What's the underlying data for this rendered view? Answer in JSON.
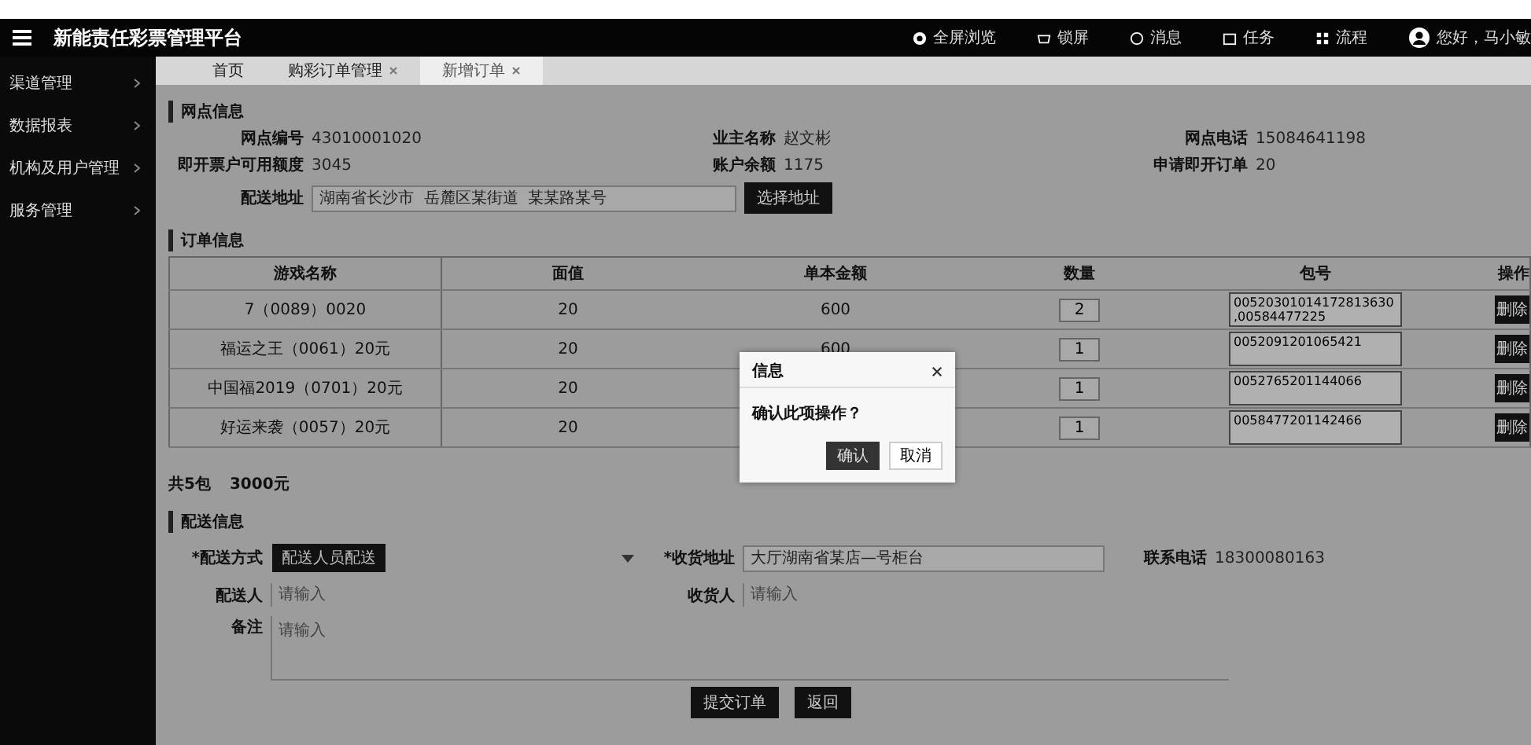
{
  "app": {
    "title": "新能责任彩票管理平台"
  },
  "top_nav": [
    {
      "kind": "fullscreen",
      "label": "全屏浏览"
    },
    {
      "kind": "lock",
      "label": "锁屏"
    },
    {
      "kind": "message",
      "label": "消息"
    },
    {
      "kind": "task",
      "label": "任务"
    },
    {
      "kind": "flow",
      "label": "流程"
    }
  ],
  "user": {
    "label": "您好，马小敏"
  },
  "sidebar": {
    "items": [
      {
        "label": "渠道管理"
      },
      {
        "label": "数据报表"
      },
      {
        "label": "机构及用户管理"
      },
      {
        "label": "服务管理"
      }
    ]
  },
  "tabs": [
    {
      "label": "首页",
      "selected": false,
      "closable": false
    },
    {
      "label": "购彩订单管理",
      "selected": false,
      "closable": true
    },
    {
      "label": "新增订单",
      "selected": true,
      "closable": true
    }
  ],
  "outlet": {
    "title": "网点信息",
    "fields": [
      {
        "label": "网点编号",
        "value": "43010001020"
      },
      {
        "label": "业主名称",
        "value": "赵文彬"
      },
      {
        "label": "网点电话",
        "value": "15084641198"
      },
      {
        "label": "即开票户可用额度",
        "value": "3045"
      },
      {
        "label": "账户余额",
        "value": "1175"
      },
      {
        "label": "申请即开订单",
        "value": "20"
      }
    ],
    "address": {
      "label": "配送地址",
      "value": "湖南省长沙市  岳麓区某街道  某某路某号",
      "button": "选择地址"
    }
  },
  "order": {
    "title": "订单信息",
    "columns": [
      "游戏名称",
      "面值",
      "单本金额",
      "数量",
      "包号",
      "操作"
    ],
    "rows": [
      {
        "game": "7（0089）0020",
        "face": "20",
        "amount": "600",
        "qty": "2",
        "packs": "00520301014172813630,00584477225",
        "action": "删除"
      },
      {
        "game": "福运之王（0061）20元",
        "face": "20",
        "amount": "600",
        "qty": "1",
        "packs": "0052091201065421",
        "action": "删除"
      },
      {
        "game": "中国福2019（0701）20元",
        "face": "20",
        "qty": "1",
        "packs": "0052765201144066",
        "action": "删除"
      },
      {
        "game": "好运来袭（0057）20元",
        "face": "20",
        "qty": "1",
        "packs": "0058477201142466",
        "action": "删除"
      }
    ],
    "total_packs": "共5包",
    "total_amount": "3000元"
  },
  "delivery": {
    "title": "配送信息",
    "method": {
      "label": "*配送方式",
      "value": "配送人员配送"
    },
    "address": {
      "label": "*收货地址",
      "value": "大厅湖南省某店—号柜台"
    },
    "phone": {
      "label": "联系电话",
      "value": "18300080163"
    },
    "courier": {
      "label": "配送人",
      "placeholder": "请输入"
    },
    "receiver": {
      "label": "收货人",
      "placeholder": "请输入"
    },
    "note": {
      "label": "备注",
      "placeholder": "请输入"
    }
  },
  "buttons": [
    {
      "kind": "primary",
      "label": "提交订单"
    },
    {
      "kind": "primary",
      "label": "返回"
    }
  ],
  "dialog": {
    "title": "信息",
    "message": "确认此项操作？",
    "buttons": [
      {
        "kind": "primary",
        "label": "确认"
      },
      {
        "kind": "secondary",
        "label": "取消"
      }
    ]
  }
}
